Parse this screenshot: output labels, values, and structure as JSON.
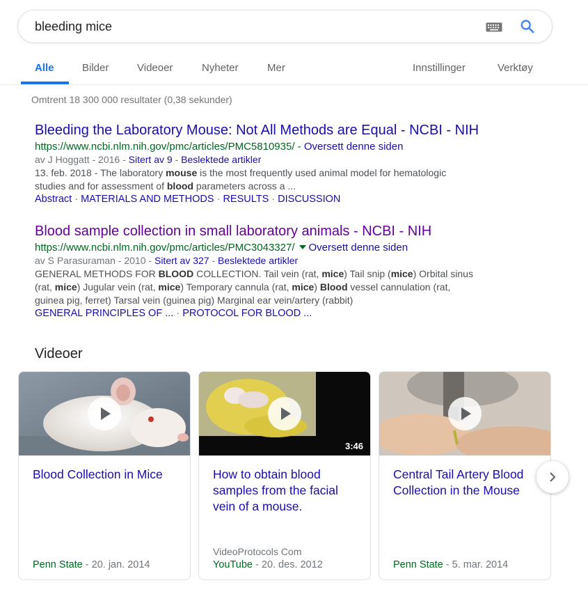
{
  "search": {
    "query": "bleeding mice",
    "keyboard_icon": "keyboard-icon",
    "search_icon": "search-icon",
    "accent_color": "#1a73e8"
  },
  "tabs": [
    {
      "label": "Alle",
      "active": true
    },
    {
      "label": "Bilder"
    },
    {
      "label": "Videoer"
    },
    {
      "label": "Nyheter"
    },
    {
      "label": "Mer"
    },
    {
      "label": "Innstillinger"
    },
    {
      "label": "Verktøy"
    }
  ],
  "stats": "Omtrent 18 300 000 resultater (0,38 sekunder)",
  "results": [
    {
      "title": "Bleeding the Laboratory Mouse: Not All Methods are Equal - NCBI - NIH",
      "url": "https://www.ncbi.nlm.nih.gov/pmc/articles/PMC5810935/",
      "url_separator": " - ",
      "translate": "Oversett denne siden",
      "meta_prefix": "av J Hoggatt - 2016 - ",
      "cited": "Sitert av 9",
      "meta_sep": " - ",
      "related": "Beslektede artikler",
      "date": "13. feb. 2018",
      "snippet_parts": [
        " - The laboratory ",
        "mouse",
        " is the most frequently used animal model for hematologic"
      ],
      "snippet_line2": [
        "studies and for assessment of ",
        "blood",
        " parameters across a ..."
      ],
      "sitelinks": [
        "Abstract",
        "MATERIALS AND METHODS",
        "RESULTS",
        "DISCUSSION"
      ],
      "sitelink_sep": " · "
    },
    {
      "title": "Blood sample collection in small laboratory animals - NCBI - NIH",
      "url": "https://www.ncbi.nlm.nih.gov/pmc/articles/PMC3043327/",
      "translate": "Oversett denne siden",
      "meta_prefix": "av S Parasuraman - 2010 - ",
      "cited": "Sitert av 327",
      "meta_sep": " - ",
      "related": "Beslektede artikler",
      "snippet_line1": [
        "GENERAL METHODS FOR ",
        "BLOOD",
        " COLLECTION. Tail vein (rat, ",
        "mice",
        ") Tail snip (",
        "mice",
        ") Orbital sinus"
      ],
      "snippet_line2": [
        "(rat, ",
        "mice",
        ") Jugular vein (rat, ",
        "mice",
        ") Temporary cannula (rat, ",
        "mice",
        ") ",
        "Blood",
        " vessel cannulation (rat,"
      ],
      "snippet_line3": "guinea pig, ferret) Tarsal vein (guinea pig) Marginal ear vein/artery (rabbit)",
      "sitelinks": [
        "GENERAL PRINCIPLES OF ...",
        "PROTOCOL FOR BLOOD ..."
      ],
      "sitelink_sep": " · "
    }
  ],
  "videos": {
    "heading": "Videoer",
    "items": [
      {
        "title": "Blood Collection in Mice",
        "channel": "",
        "source": "Penn State",
        "date_sep": " - ",
        "date": "20. jan. 2014",
        "duration": ""
      },
      {
        "title": "How to obtain blood samples from the facial vein of a mouse.",
        "channel": "VideoProtocols Com",
        "source": "YouTube",
        "date_sep": " - ",
        "date": "20. des. 2012",
        "duration": "3:46"
      },
      {
        "title": "Central Tail Artery Blood Collection in the Mouse",
        "channel": "",
        "source": "Penn State",
        "date_sep": " - ",
        "date": "5. mar. 2014",
        "duration": ""
      }
    ],
    "next_icon": "chevron-right-icon"
  }
}
